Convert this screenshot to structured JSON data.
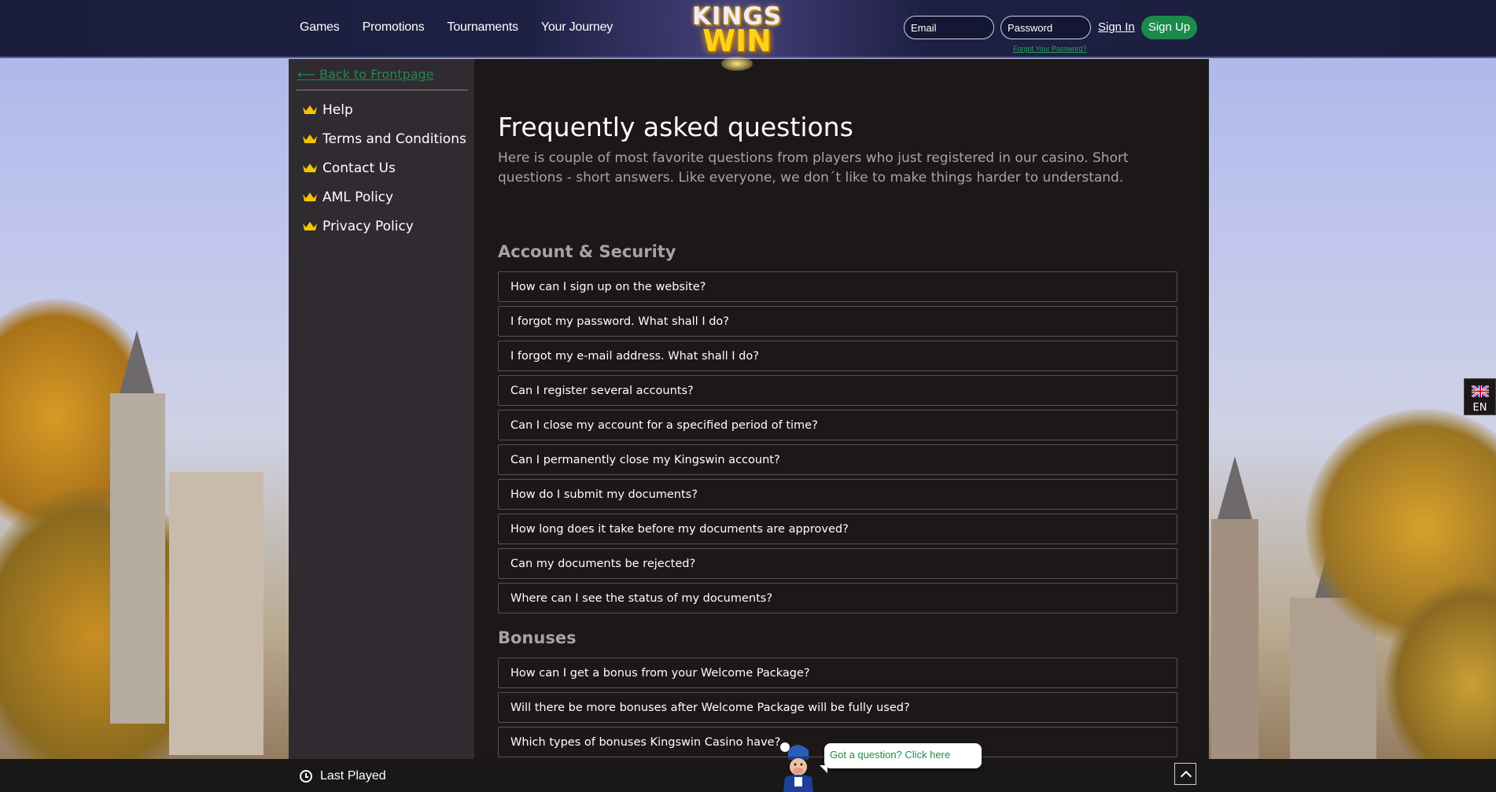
{
  "header": {
    "nav": [
      "Games",
      "Promotions",
      "Tournaments",
      "Your Journey"
    ],
    "logo_line1": "KINGS",
    "logo_line2": "WIN",
    "email_placeholder": "Email",
    "password_placeholder": "Password",
    "sign_in": "Sign In",
    "sign_up": "Sign Up",
    "forgot_password": "Forgot Your Password?"
  },
  "sidebar": {
    "back_label": "⟵ Back to Frontpage",
    "items": [
      "Help",
      "Terms and Conditions",
      "Contact Us",
      "AML Policy",
      "Privacy Policy"
    ]
  },
  "main": {
    "title": "Frequently asked questions",
    "intro": "Here is couple of most favorite questions from players who just registered in our casino. Short questions - short answers. Like everyone, we don´t like to make things harder to understand.",
    "sections": [
      {
        "title": "Account & Security",
        "questions": [
          "How can I sign up on the website?",
          "I forgot my password. What shall I do?",
          "I forgot my e-mail address. What shall I do?",
          "Can I register several accounts?",
          "Can I close my account for a specified period of time?",
          "Can I permanently close my Kingswin account?",
          "How do I submit my documents?",
          "How long does it take before my documents are approved?",
          "Can my documents be rejected?",
          "Where can I see the status of my documents?"
        ]
      },
      {
        "title": "Bonuses",
        "questions": [
          "How can I get a bonus from your Welcome Package?",
          "Will there be more bonuses after Welcome Package will be fully used?",
          "Which types of bonuses Kingswin Casino have?"
        ]
      }
    ]
  },
  "language": {
    "code": "EN"
  },
  "bottom": {
    "last_played": "Last Played"
  },
  "chat": {
    "label": "Got a question? Click here"
  },
  "colors": {
    "accent_green": "#1c8a4a",
    "crown_gold": "#f5c400",
    "header_bg": "#1d2043"
  }
}
